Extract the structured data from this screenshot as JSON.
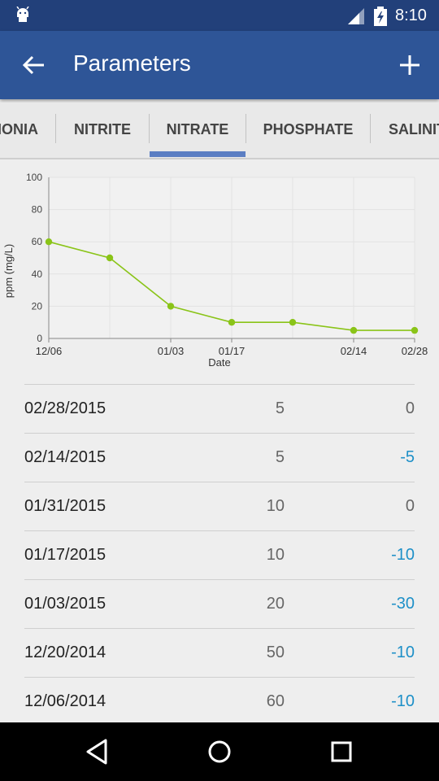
{
  "status_bar": {
    "time": "8:10",
    "icons": [
      "android-icon",
      "signal-icon",
      "battery-charging-icon"
    ]
  },
  "app_bar": {
    "title": "Parameters",
    "icons": [
      "back-arrow-icon",
      "add-icon"
    ]
  },
  "tabs": [
    {
      "label": "IONIA",
      "active": false
    },
    {
      "label": "NITRITE",
      "active": false
    },
    {
      "label": "NITRATE",
      "active": true
    },
    {
      "label": "PHOSPHATE",
      "active": false
    },
    {
      "label": "SALINIT",
      "active": false
    }
  ],
  "chart_data": {
    "type": "line",
    "xlabel": "Date",
    "ylabel": "ppm (mg/L)",
    "ylim": [
      0,
      100
    ],
    "yticks": [
      "0",
      "20",
      "40",
      "60",
      "80",
      "100"
    ],
    "x_tick_labels": [
      "12/06",
      "01/03",
      "01/17",
      "02/14",
      "02/28"
    ],
    "grid": true,
    "series_color": "#8ac418",
    "points": [
      {
        "x": "2014-12-06",
        "y": 60
      },
      {
        "x": "2014-12-20",
        "y": 50
      },
      {
        "x": "2015-01-03",
        "y": 20
      },
      {
        "x": "2015-01-17",
        "y": 10
      },
      {
        "x": "2015-01-31",
        "y": 10
      },
      {
        "x": "2015-02-14",
        "y": 5
      },
      {
        "x": "2015-02-28",
        "y": 5
      }
    ]
  },
  "readings": [
    {
      "date": "02/28/2015",
      "value": "5",
      "change": "0",
      "negative": false
    },
    {
      "date": "02/14/2015",
      "value": "5",
      "change": "-5",
      "negative": true
    },
    {
      "date": "01/31/2015",
      "value": "10",
      "change": "0",
      "negative": false
    },
    {
      "date": "01/17/2015",
      "value": "10",
      "change": "-10",
      "negative": true
    },
    {
      "date": "01/03/2015",
      "value": "20",
      "change": "-30",
      "negative": true
    },
    {
      "date": "12/20/2014",
      "value": "50",
      "change": "-10",
      "negative": true
    },
    {
      "date": "12/06/2014",
      "value": "60",
      "change": "-10",
      "negative": true
    }
  ],
  "colors": {
    "status_bar": "#22407a",
    "app_bar": "#2e5597",
    "tab_indicator": "#5b7ec3",
    "negative_change": "#1e90c8"
  },
  "nav_bar": {
    "icons": [
      "back-triangle-icon",
      "home-circle-icon",
      "recents-square-icon"
    ]
  }
}
